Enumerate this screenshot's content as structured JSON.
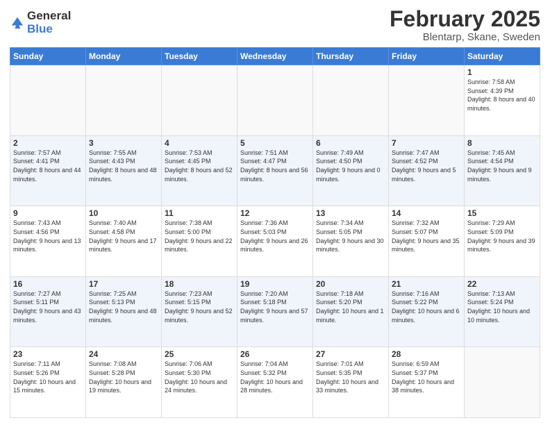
{
  "header": {
    "logo_general": "General",
    "logo_blue": "Blue",
    "title": "February 2025",
    "subtitle": "Blentarp, Skane, Sweden"
  },
  "days_of_week": [
    "Sunday",
    "Monday",
    "Tuesday",
    "Wednesday",
    "Thursday",
    "Friday",
    "Saturday"
  ],
  "weeks": [
    [
      {
        "day": "",
        "info": ""
      },
      {
        "day": "",
        "info": ""
      },
      {
        "day": "",
        "info": ""
      },
      {
        "day": "",
        "info": ""
      },
      {
        "day": "",
        "info": ""
      },
      {
        "day": "",
        "info": ""
      },
      {
        "day": "1",
        "info": "Sunrise: 7:58 AM\nSunset: 4:39 PM\nDaylight: 8 hours and 40 minutes."
      }
    ],
    [
      {
        "day": "2",
        "info": "Sunrise: 7:57 AM\nSunset: 4:41 PM\nDaylight: 8 hours and 44 minutes."
      },
      {
        "day": "3",
        "info": "Sunrise: 7:55 AM\nSunset: 4:43 PM\nDaylight: 8 hours and 48 minutes."
      },
      {
        "day": "4",
        "info": "Sunrise: 7:53 AM\nSunset: 4:45 PM\nDaylight: 8 hours and 52 minutes."
      },
      {
        "day": "5",
        "info": "Sunrise: 7:51 AM\nSunset: 4:47 PM\nDaylight: 8 hours and 56 minutes."
      },
      {
        "day": "6",
        "info": "Sunrise: 7:49 AM\nSunset: 4:50 PM\nDaylight: 9 hours and 0 minutes."
      },
      {
        "day": "7",
        "info": "Sunrise: 7:47 AM\nSunset: 4:52 PM\nDaylight: 9 hours and 5 minutes."
      },
      {
        "day": "8",
        "info": "Sunrise: 7:45 AM\nSunset: 4:54 PM\nDaylight: 9 hours and 9 minutes."
      }
    ],
    [
      {
        "day": "9",
        "info": "Sunrise: 7:43 AM\nSunset: 4:56 PM\nDaylight: 9 hours and 13 minutes."
      },
      {
        "day": "10",
        "info": "Sunrise: 7:40 AM\nSunset: 4:58 PM\nDaylight: 9 hours and 17 minutes."
      },
      {
        "day": "11",
        "info": "Sunrise: 7:38 AM\nSunset: 5:00 PM\nDaylight: 9 hours and 22 minutes."
      },
      {
        "day": "12",
        "info": "Sunrise: 7:36 AM\nSunset: 5:03 PM\nDaylight: 9 hours and 26 minutes."
      },
      {
        "day": "13",
        "info": "Sunrise: 7:34 AM\nSunset: 5:05 PM\nDaylight: 9 hours and 30 minutes."
      },
      {
        "day": "14",
        "info": "Sunrise: 7:32 AM\nSunset: 5:07 PM\nDaylight: 9 hours and 35 minutes."
      },
      {
        "day": "15",
        "info": "Sunrise: 7:29 AM\nSunset: 5:09 PM\nDaylight: 9 hours and 39 minutes."
      }
    ],
    [
      {
        "day": "16",
        "info": "Sunrise: 7:27 AM\nSunset: 5:11 PM\nDaylight: 9 hours and 43 minutes."
      },
      {
        "day": "17",
        "info": "Sunrise: 7:25 AM\nSunset: 5:13 PM\nDaylight: 9 hours and 48 minutes."
      },
      {
        "day": "18",
        "info": "Sunrise: 7:23 AM\nSunset: 5:15 PM\nDaylight: 9 hours and 52 minutes."
      },
      {
        "day": "19",
        "info": "Sunrise: 7:20 AM\nSunset: 5:18 PM\nDaylight: 9 hours and 57 minutes."
      },
      {
        "day": "20",
        "info": "Sunrise: 7:18 AM\nSunset: 5:20 PM\nDaylight: 10 hours and 1 minute."
      },
      {
        "day": "21",
        "info": "Sunrise: 7:16 AM\nSunset: 5:22 PM\nDaylight: 10 hours and 6 minutes."
      },
      {
        "day": "22",
        "info": "Sunrise: 7:13 AM\nSunset: 5:24 PM\nDaylight: 10 hours and 10 minutes."
      }
    ],
    [
      {
        "day": "23",
        "info": "Sunrise: 7:11 AM\nSunset: 5:26 PM\nDaylight: 10 hours and 15 minutes."
      },
      {
        "day": "24",
        "info": "Sunrise: 7:08 AM\nSunset: 5:28 PM\nDaylight: 10 hours and 19 minutes."
      },
      {
        "day": "25",
        "info": "Sunrise: 7:06 AM\nSunset: 5:30 PM\nDaylight: 10 hours and 24 minutes."
      },
      {
        "day": "26",
        "info": "Sunrise: 7:04 AM\nSunset: 5:32 PM\nDaylight: 10 hours and 28 minutes."
      },
      {
        "day": "27",
        "info": "Sunrise: 7:01 AM\nSunset: 5:35 PM\nDaylight: 10 hours and 33 minutes."
      },
      {
        "day": "28",
        "info": "Sunrise: 6:59 AM\nSunset: 5:37 PM\nDaylight: 10 hours and 38 minutes."
      },
      {
        "day": "",
        "info": ""
      }
    ]
  ]
}
